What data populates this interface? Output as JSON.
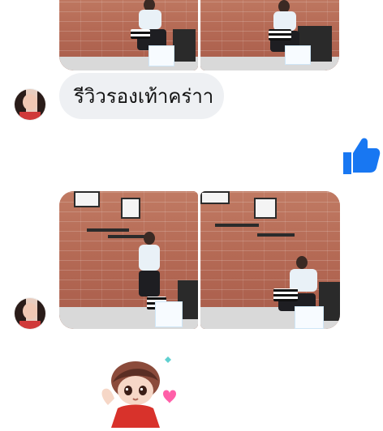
{
  "conversation": {
    "message_text": "รีวิวรองเท้าคร่าา",
    "colors": {
      "bubble_bg": "#eef0f3",
      "like_blue": "#1877f2",
      "sticker_red": "#d8322b"
    },
    "icons": {
      "like": "thumbs-up-icon",
      "sticker": "boy-sticker-icon",
      "avatar": "profile-avatar"
    }
  }
}
